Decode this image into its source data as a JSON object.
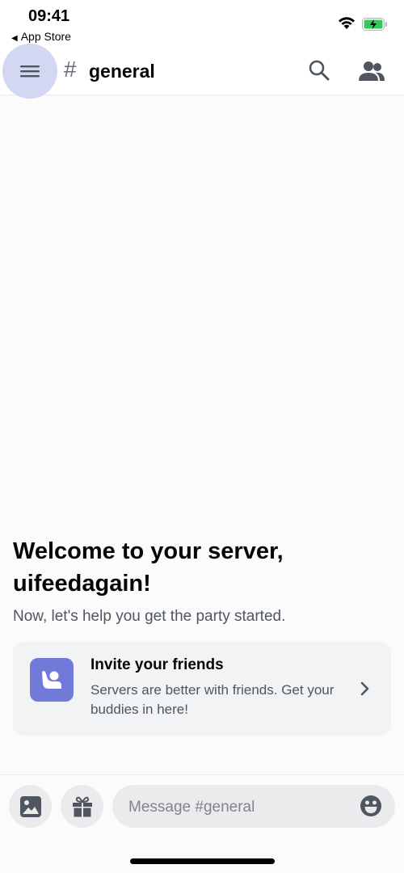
{
  "status_bar": {
    "time": "09:41",
    "back_app": "App Store",
    "back_arrow": "◀",
    "wifi_icon": "wifi-icon",
    "battery_icon": "battery-charging-icon"
  },
  "header": {
    "menu_icon": "hamburger-menu-icon",
    "channel_prefix": "#",
    "channel_name": "general",
    "search_icon": "search-icon",
    "members_icon": "members-icon"
  },
  "welcome": {
    "title": "Welcome to your server, uifeedagain!",
    "subtitle": "Now, let's help you get the party started."
  },
  "invite_card": {
    "icon": "wave-user-icon",
    "title": "Invite your friends",
    "description": "Servers are better with friends. Get your buddies in here!",
    "chevron": "chevron-right-icon",
    "accent_color": "#7179d9"
  },
  "composer": {
    "image_button_icon": "image-icon",
    "gift_button_icon": "gift-icon",
    "placeholder": "Message #general",
    "value": "",
    "emoji_icon": "emoji-icon"
  }
}
